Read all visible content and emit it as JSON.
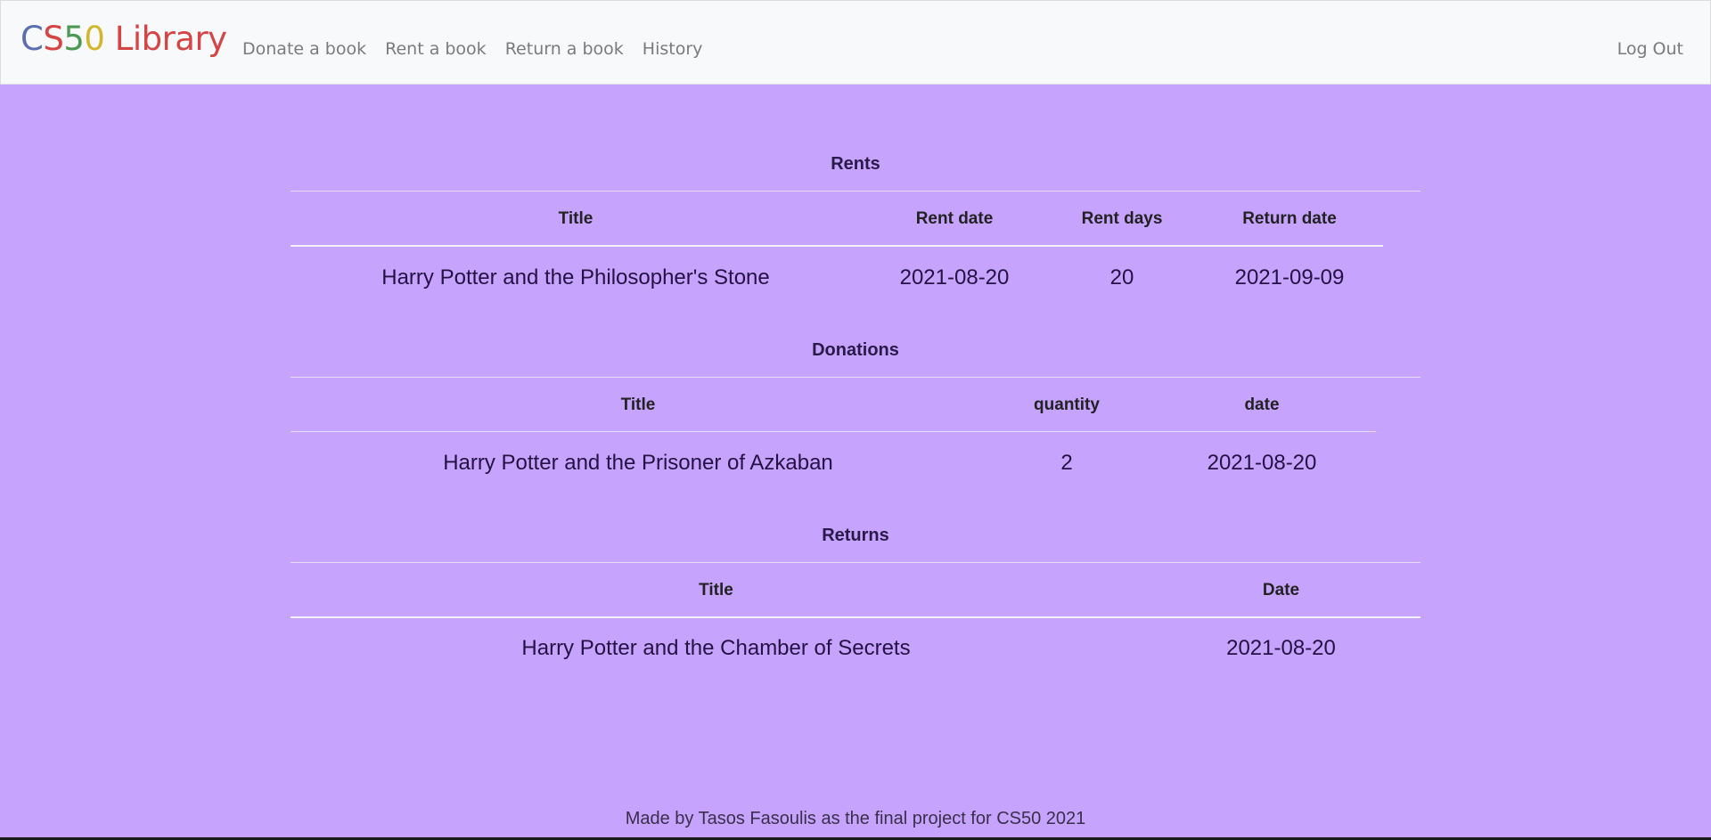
{
  "navbar": {
    "brand": {
      "c": "C",
      "s": "S",
      "five": "5",
      "zero": "0",
      "rest": " Library"
    },
    "links": [
      "Donate a book",
      "Rent a book",
      "Return a book",
      "History"
    ],
    "logout": "Log Out"
  },
  "rents": {
    "title": "Rents",
    "headers": [
      "Title",
      "Rent date",
      "Rent days",
      "Return date"
    ],
    "rows": [
      [
        "Harry Potter and the Philosopher's Stone",
        "2021-08-20",
        "20",
        "2021-09-09"
      ]
    ]
  },
  "donations": {
    "title": "Donations",
    "headers": [
      "Title",
      "quantity",
      "date"
    ],
    "rows": [
      [
        "Harry Potter and the Prisoner of Azkaban",
        "2",
        "2021-08-20"
      ]
    ]
  },
  "returns": {
    "title": "Returns",
    "headers": [
      "Title",
      "Date"
    ],
    "rows": [
      [
        "Harry Potter and the Chamber of Secrets",
        "2021-08-20"
      ]
    ]
  },
  "footer": {
    "text": "Made by Tasos Fasoulis as the final project for CS50 2021"
  },
  "colors": {
    "background": "#c6a3fd",
    "navbar": "#f8f9fb",
    "nav_link": "#7b7b7b"
  }
}
